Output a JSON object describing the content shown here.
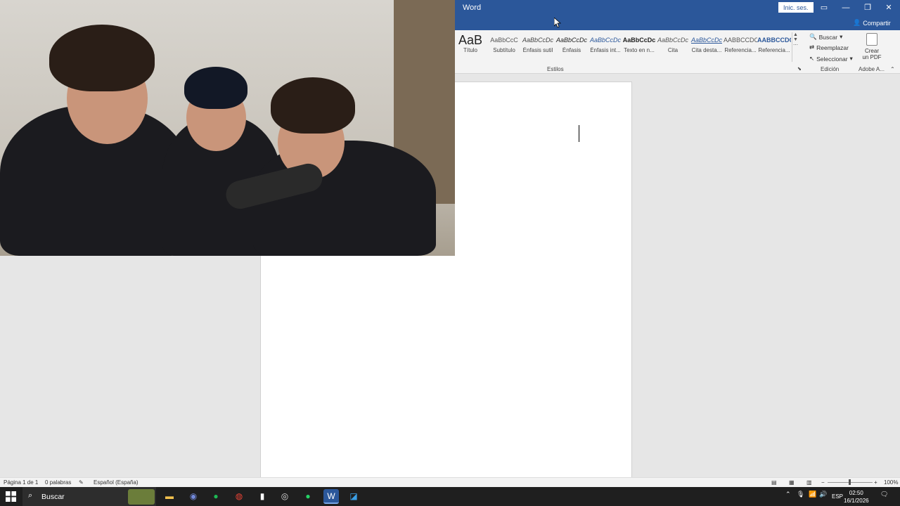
{
  "window": {
    "title": "Word",
    "sign_in": "Inic. ses.",
    "share": "Compartir"
  },
  "ribbon": {
    "styles": [
      {
        "sample": "AaB",
        "name": "Título"
      },
      {
        "sample": "AaBbCcC",
        "name": "Subtítulo"
      },
      {
        "sample": "AaBbCcDc",
        "name": "Énfasis sutil"
      },
      {
        "sample": "AaBbCcDc",
        "name": "Énfasis"
      },
      {
        "sample": "AaBbCcDc",
        "name": "Énfasis int..."
      },
      {
        "sample": "AaBbCcDc",
        "name": "Texto en n..."
      },
      {
        "sample": "AaBbCcDc",
        "name": "Cita"
      },
      {
        "sample": "AaBbCcDc",
        "name": "Cita desta..."
      },
      {
        "sample": "AABBCCDC",
        "name": "Referencia..."
      },
      {
        "sample": "AABBCCDC",
        "name": "Referencia..."
      }
    ],
    "styles_group": "Estilos",
    "editing": {
      "find": "Buscar",
      "replace": "Reemplazar",
      "select": "Seleccionar",
      "group": "Edición"
    },
    "pdf": {
      "line1": "Crear",
      "line2": "un PDF",
      "group": "Adobe A..."
    }
  },
  "statusbar": {
    "page": "Página 1 de 1",
    "words": "0 palabras",
    "language": "Español (España)",
    "zoom": "100%"
  },
  "taskbar": {
    "search": "Buscar",
    "lang": "ESP",
    "time": "02:50",
    "date": "16/1/2026"
  },
  "colors": {
    "word_blue": "#2b579a",
    "taskbar": "#1f1f1f"
  }
}
